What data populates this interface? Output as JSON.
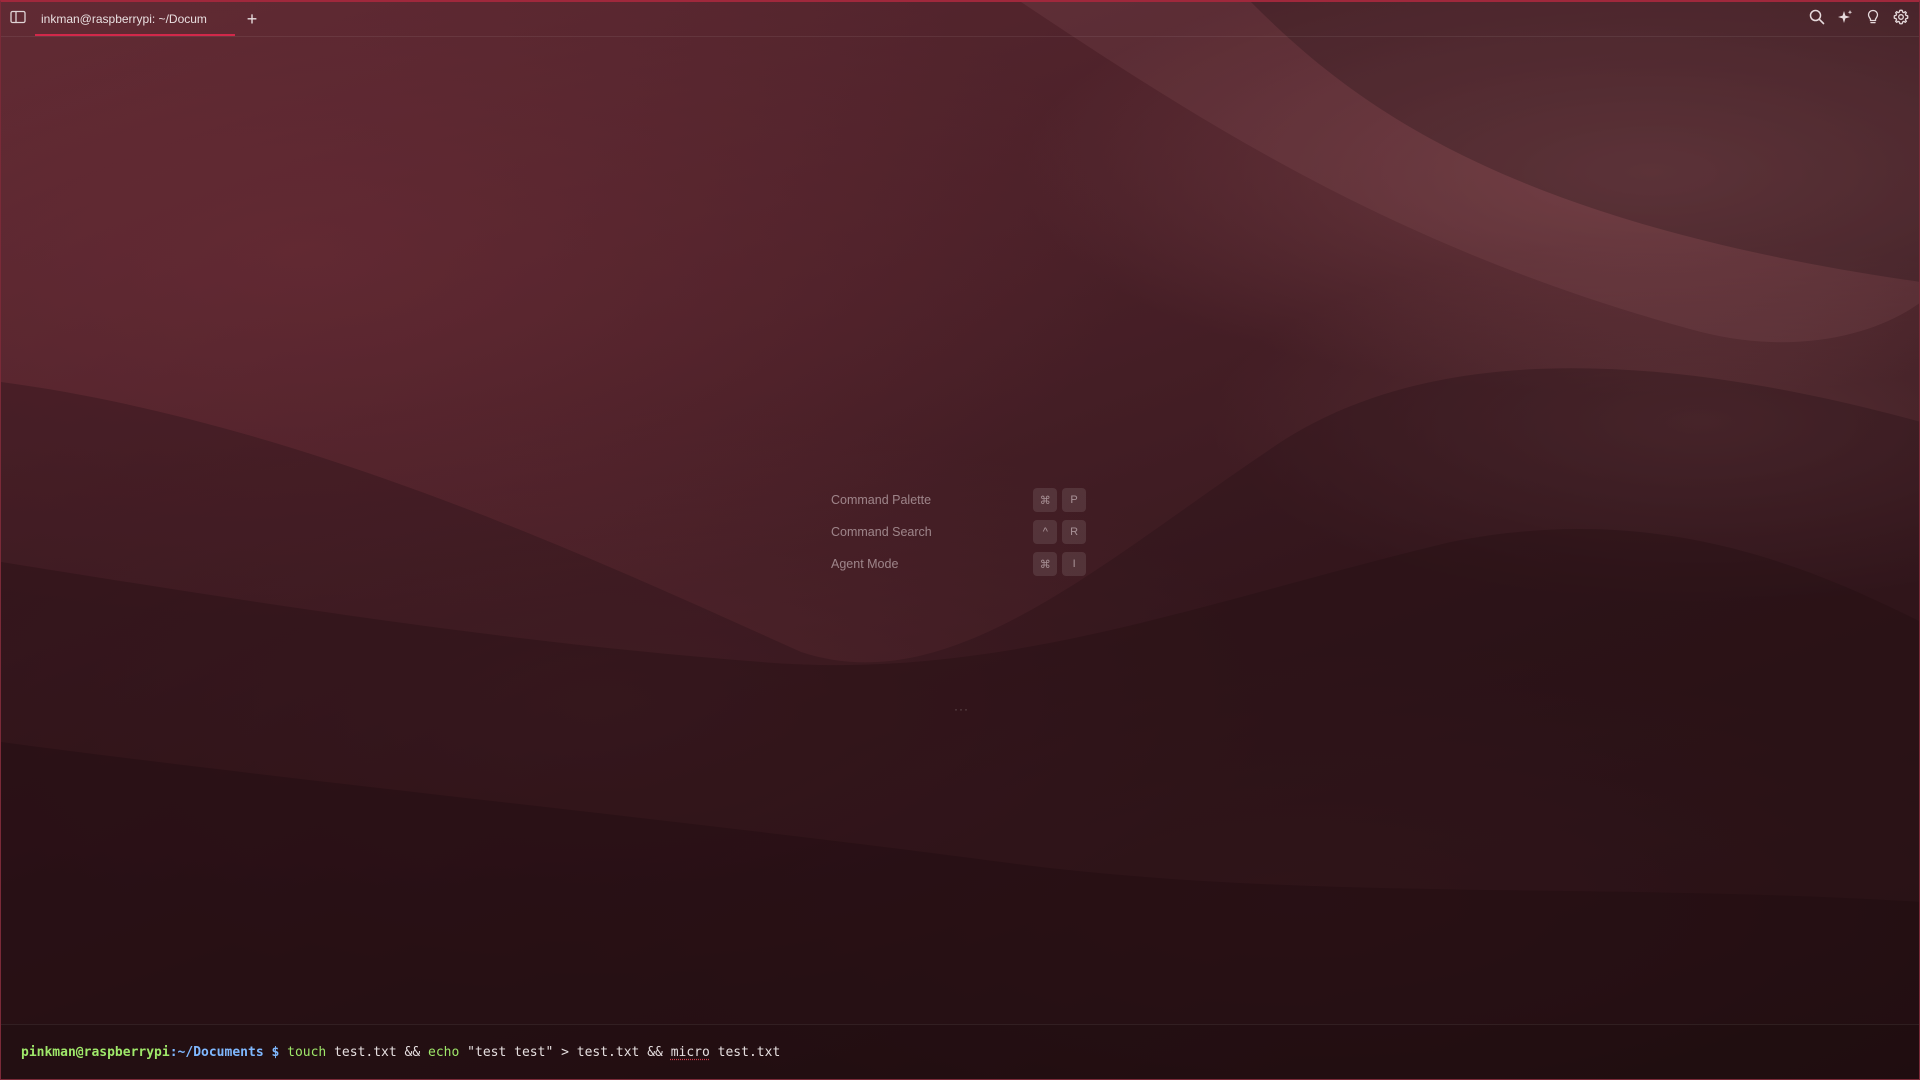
{
  "window": {
    "accent_color": "#d2284a",
    "background_theme": "red canyon sandstone"
  },
  "tabbar": {
    "sidebar_toggle_icon": "sidebar-toggle-icon",
    "tabs": [
      {
        "title": "inkman@raspberrypi: ~/Docum",
        "active": true
      }
    ],
    "new_tab_label": "+",
    "right_icons": [
      "search-icon",
      "ai-sparkle-icon",
      "lightbulb-icon",
      "gear-icon"
    ]
  },
  "shortcuts": [
    {
      "label": "Command Palette",
      "keys": [
        "⌘",
        "P"
      ]
    },
    {
      "label": "Command Search",
      "keys": [
        "^",
        "R"
      ]
    },
    {
      "label": "Agent Mode",
      "keys": [
        "⌘",
        "I"
      ]
    }
  ],
  "center_dots": "···",
  "prompt": {
    "user_host": "pinkman@raspberrypi",
    "colon": ":",
    "path": "~/Documents",
    "symbol": "$",
    "command_parts": [
      {
        "text": "touch",
        "kind": "cmd"
      },
      {
        "text": "test.txt",
        "kind": "arg"
      },
      {
        "text": "&&",
        "kind": "op"
      },
      {
        "text": "echo",
        "kind": "cmd"
      },
      {
        "text": "\"test test\"",
        "kind": "str"
      },
      {
        "text": ">",
        "kind": "op"
      },
      {
        "text": "test.txt",
        "kind": "arg"
      },
      {
        "text": "&&",
        "kind": "op"
      },
      {
        "text": "micro",
        "kind": "micro"
      },
      {
        "text": "test.txt",
        "kind": "arg"
      }
    ],
    "colors": {
      "user": "#9fe86a",
      "path": "#7fb8ff",
      "command": "#9fe86a"
    }
  }
}
